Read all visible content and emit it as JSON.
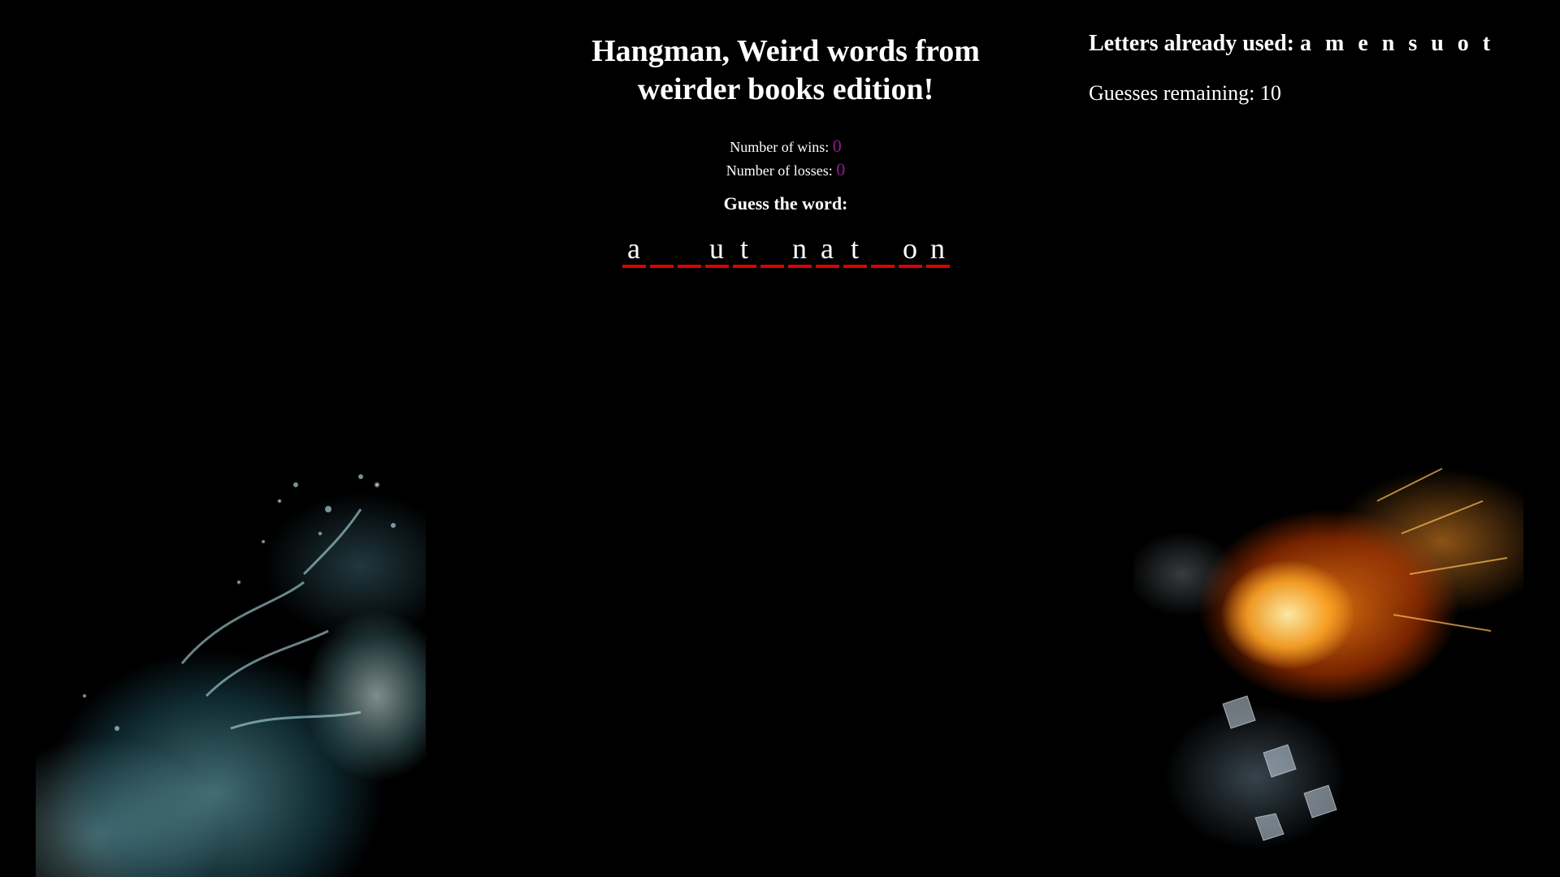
{
  "game": {
    "title": "Hangman, Weird words from weirder books edition!",
    "wins_label": "Number of wins:",
    "wins_value": "0",
    "losses_label": "Number of losses:",
    "losses_value": "0",
    "guess_heading": "Guess the word:",
    "word_slots": [
      "a",
      "",
      "",
      "u",
      "t",
      "",
      "n",
      "a",
      "t",
      "",
      "o",
      "n"
    ]
  },
  "info": {
    "used_label": "Letters already used:",
    "used_letters": "a m e n s u o t",
    "remaining_label": "Guesses remaining:",
    "remaining_value": "10"
  },
  "colors": {
    "background": "#000000",
    "text": "#ffffff",
    "stat_value": "#8b1f8b",
    "underline": "#e00000"
  },
  "images": {
    "left": "water-fist-image",
    "right": "fire-fist-image"
  }
}
